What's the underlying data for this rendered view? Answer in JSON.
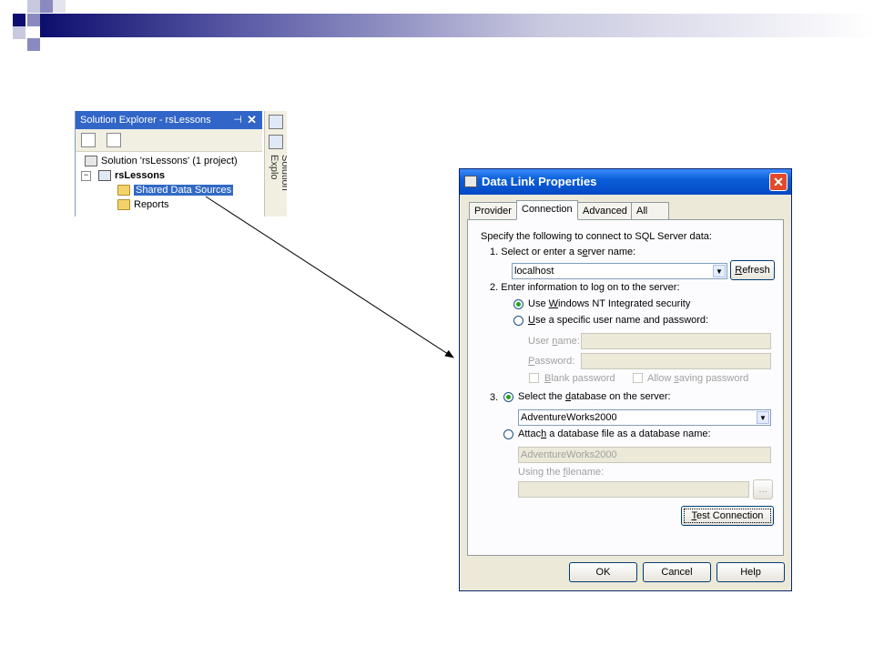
{
  "solution_explorer": {
    "title": "Solution Explorer - rsLessons",
    "pin_glyph": "⊣",
    "close_glyph": "✕",
    "side_tab_label": "Solution Explo",
    "tree": {
      "solution": "Solution 'rsLessons' (1 project)",
      "project": "rsLessons",
      "items": [
        "Shared Data Sources",
        "Reports"
      ],
      "selected": "Shared Data Sources"
    }
  },
  "dialog": {
    "title": "Data Link Properties",
    "close_glyph": "✕",
    "tabs": [
      "Provider",
      "Connection",
      "Advanced",
      "All"
    ],
    "active_tab": "Connection",
    "intro": "Specify the following to connect to SQL Server data:",
    "step1": {
      "label_pre": "1. Select or enter a s",
      "label_u": "e",
      "label_post": "rver name:",
      "server_value": "localhost",
      "refresh_u": "R",
      "refresh_rest": "efresh"
    },
    "step2": {
      "label": "2. Enter information to log on to the server:",
      "opt_nt_pre": "Use ",
      "opt_nt_u": "W",
      "opt_nt_post": "indows NT Integrated security",
      "opt_sql_u": "U",
      "opt_sql_post": "se a specific user name and password:",
      "user_pre": "User ",
      "user_u": "n",
      "user_post": "ame:",
      "pw_u": "P",
      "pw_post": "assword:",
      "blank_u": "B",
      "blank_post": "lank password",
      "allow_pre": "Allow ",
      "allow_u": "s",
      "allow_post": "aving password"
    },
    "step3": {
      "num": "3.",
      "opt_db_pre": "Select the ",
      "opt_db_u": "d",
      "opt_db_post": "atabase on the server:",
      "db_value": "AdventureWorks2000",
      "opt_attach_pre": "Attac",
      "opt_attach_u": "h",
      "opt_attach_post": " a database file as a database name:",
      "attach_value": "AdventureWorks2000",
      "filename_pre": "Using the ",
      "filename_u": "f",
      "filename_post": "ilename:",
      "browse": "...",
      "test_u": "T",
      "test_rest": "est Connection"
    },
    "buttons": {
      "ok": "OK",
      "cancel": "Cancel",
      "help": "Help"
    }
  }
}
